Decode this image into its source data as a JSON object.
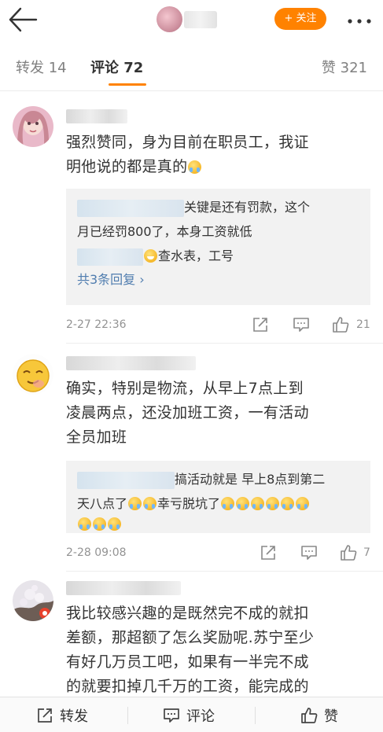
{
  "header": {
    "follow_label": "关注",
    "follow_plus": "+"
  },
  "tabs": {
    "repost": "转发 14",
    "comments": "评论 72",
    "likes": "赞 321"
  },
  "comments": [
    {
      "text_line1": "强烈赞同，身为目前在职员工，我证",
      "text_line2": "明他说的都是真的",
      "reply_line1": "关键是还有罚款，这个",
      "reply_line2": "月已经罚800了，本身工资就低",
      "reply_line3": "查水表，工号",
      "more_replies": "共3条回复 ›",
      "timestamp": "2-27 22:36",
      "like_count": "21"
    },
    {
      "text_line1": "确实，特别是物流，从早上7点上到",
      "text_line2": "凌晨两点，还没加班工资，一有活动",
      "text_line3": "全员加班",
      "reply_line1": "搞活动就是 早上8点到第二",
      "reply_line2": "天八点了",
      "reply_line2b": "幸亏脱坑了",
      "timestamp": "2-28 09:08",
      "like_count": "7"
    },
    {
      "text_line1": "我比较感兴趣的是既然完不成的就扣",
      "text_line2": "差额，那超额了怎么奖励呢.苏宁至少",
      "text_line3": "有好几万员工吧，如果有一半完不成",
      "text_line4": "的就要扣掉几千万的工资，能完成的"
    }
  ],
  "bottom_bar": {
    "repost": "转发",
    "comment": "评论",
    "like": "赞"
  },
  "colors": {
    "accent": "#ff8200",
    "link": "#507daf",
    "muted": "#939393"
  },
  "icons": [
    "back-arrow-icon",
    "more-icon",
    "share-icon",
    "comment-icon",
    "thumbs-up-icon"
  ]
}
